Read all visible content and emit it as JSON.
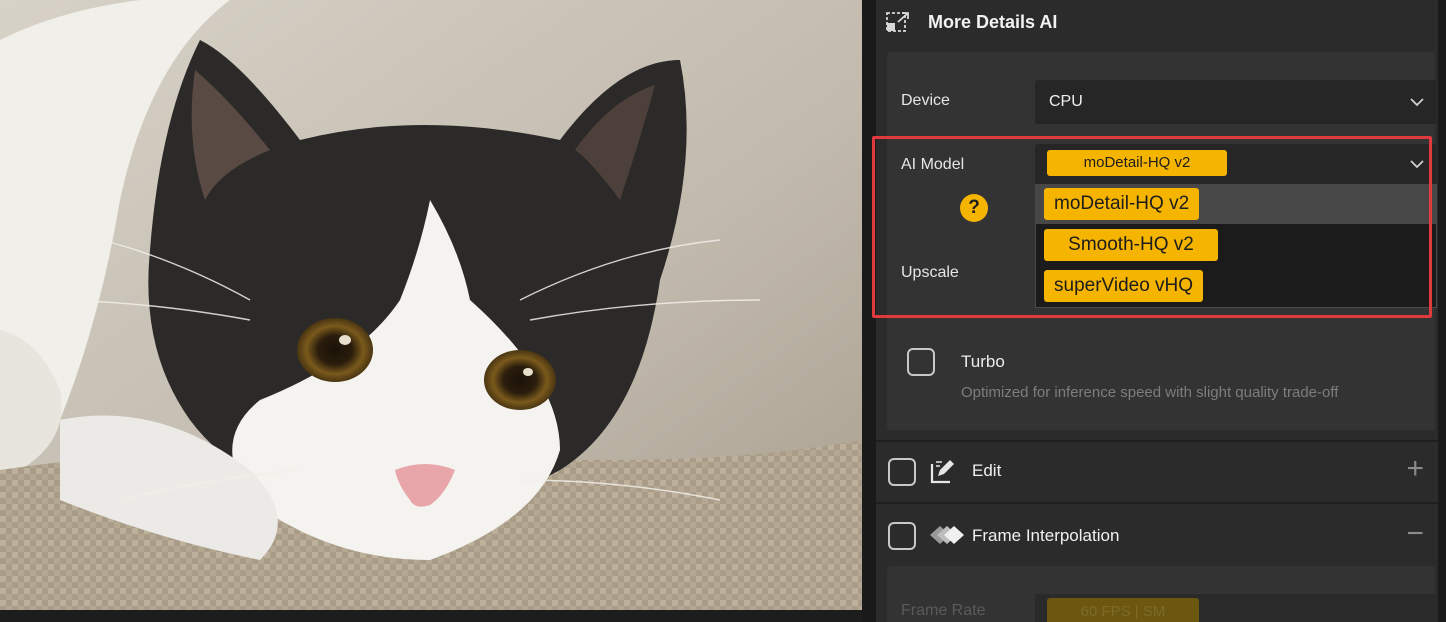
{
  "panel": {
    "title": "More Details AI",
    "device": {
      "label": "Device",
      "value": "CPU"
    },
    "ai_model": {
      "label": "AI Model",
      "selected": "moDetail-HQ  v2",
      "options": [
        "moDetail-HQ  v2",
        "Smooth-HQ  v2",
        "superVideo vHQ"
      ],
      "active_index": 0,
      "help": "?"
    },
    "upscale": {
      "label": "Upscale"
    },
    "turbo": {
      "label": "Turbo",
      "description": "Optimized for inference speed with slight quality trade-off",
      "checked": false
    }
  },
  "sections": {
    "edit": {
      "label": "Edit",
      "expand_symbol": "+"
    },
    "frame_interpolation": {
      "label": "Frame Interpolation",
      "collapse_symbol": "−",
      "frame_rate_label": "Frame Rate",
      "frame_rate_value": "60 FPS | SM"
    }
  },
  "colors": {
    "accent": "#f5b400",
    "highlight": "#e0393e",
    "panel_bg": "#2b2b2b"
  }
}
